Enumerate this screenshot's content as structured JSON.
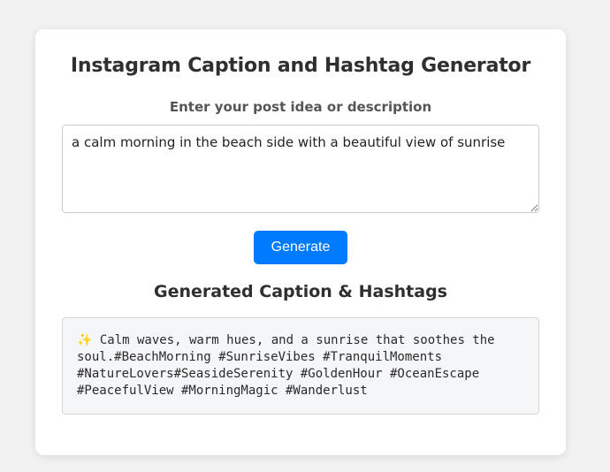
{
  "app": {
    "title": "Instagram Caption and Hashtag Generator"
  },
  "input": {
    "label": "Enter your post idea or description",
    "value": "a calm morning in the beach side with a beautiful view of sunrise"
  },
  "actions": {
    "generate_label": "Generate"
  },
  "result": {
    "heading": "Generated Caption & Hashtags",
    "text": "✨ Calm waves, warm hues, and a sunrise that soothes the soul.#BeachMorning #SunriseVibes #TranquilMoments #NatureLovers#SeasideSerenity #GoldenHour #OceanEscape #PeacefulView #MorningMagic #Wanderlust"
  },
  "colors": {
    "page_background": "#f2f2f2",
    "card_background": "#ffffff",
    "accent": "#007bff",
    "output_background": "#f5f6f8"
  }
}
